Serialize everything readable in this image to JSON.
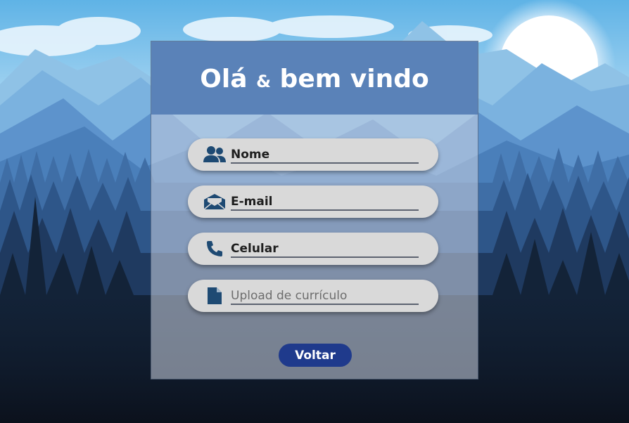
{
  "header": {
    "title_part1": "Olá",
    "title_amp": "&",
    "title_part2": "bem vindo"
  },
  "form": {
    "fields": [
      {
        "icon": "users-icon",
        "placeholder": "Nome"
      },
      {
        "icon": "envelope-open-icon",
        "placeholder": "E-mail"
      },
      {
        "icon": "phone-icon",
        "placeholder": "Celular"
      },
      {
        "icon": "file-icon",
        "placeholder": "Upload de currículo"
      }
    ],
    "back_label": "Voltar"
  },
  "colors": {
    "header_bg": "#5a82b8",
    "field_bg": "#d9d9d9",
    "icon_color": "#1e4a73",
    "button_bg": "#1f3a8c"
  }
}
